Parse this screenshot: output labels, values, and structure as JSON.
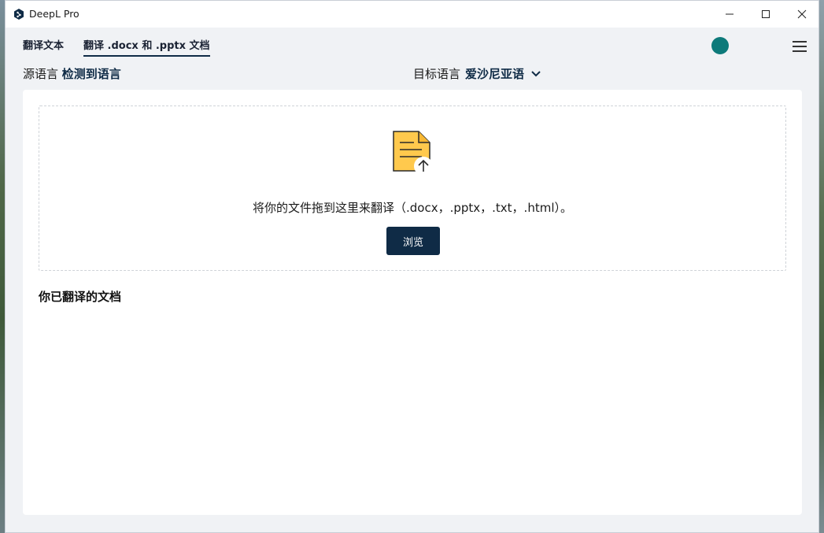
{
  "window": {
    "title": "DeepL Pro",
    "controls": {
      "minimize": "minimize-icon",
      "maximize": "maximize-icon",
      "close": "close-icon"
    }
  },
  "tabs": [
    {
      "label": "翻译文本",
      "active": false
    },
    {
      "label": "翻译 .docx 和 .pptx 文档",
      "active": true
    }
  ],
  "header": {
    "avatar_color": "#0d7a7a",
    "menu_icon": "hamburger-menu-icon"
  },
  "languages": {
    "source_label": "源语言",
    "source_value": "检测到语言",
    "target_label": "目标语言",
    "target_value": "爱沙尼亚语"
  },
  "dropzone": {
    "icon": "document-upload-icon",
    "instruction": "将你的文件拖到这里来翻译（.docx，.pptx，.txt，.html）。",
    "browse_label": "浏览"
  },
  "history": {
    "title": "你已翻译的文档"
  },
  "colors": {
    "accent": "#0f2b46",
    "doc_icon_fill": "#ffc94d",
    "background": "#f0f2f5"
  }
}
